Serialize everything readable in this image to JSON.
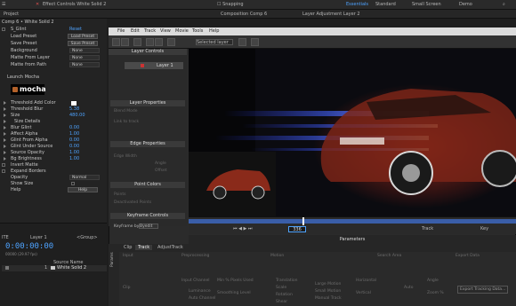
{
  "topbar": {
    "effect_controls_tab": "Effect Controls White Solid 2",
    "snapping": "Snapping",
    "workspaces": [
      "Essentials",
      "Standard",
      "Small Screen",
      "Demo"
    ],
    "search_placeholder": "Search Help"
  },
  "tabbar": {
    "project": "Project",
    "comp_tab": "Composition Comp 6",
    "layer_tab": "Layer Adjustment Layer 2"
  },
  "effect_controls": {
    "comp_layer": "Comp 6 • White Solid 2",
    "effect_name": "S_Glint",
    "reset": "Reset",
    "rows": [
      {
        "label": "Load Preset",
        "button": "Load Preset"
      },
      {
        "label": "Save Preset",
        "button": "Save Preset"
      },
      {
        "label": "Background",
        "dropdown": "None"
      },
      {
        "label": "Matte From Layer",
        "dropdown": "None"
      },
      {
        "label": "Matte from Path",
        "dropdown": "None"
      }
    ],
    "launch_mocha": "Launch Mocha",
    "mocha_logo": "mocha",
    "params": [
      {
        "label": "Threshold Add Color",
        "value": ""
      },
      {
        "label": "Threshold Blur",
        "value": "5.38"
      },
      {
        "label": "Size",
        "value": "480.00"
      },
      {
        "label": "Size Details",
        "value": ""
      },
      {
        "label": "Blur Glint",
        "value": "0.00"
      },
      {
        "label": "Affect Alpha",
        "value": "1.00"
      },
      {
        "label": "Glint From Alpha",
        "value": "0.00"
      },
      {
        "label": "Glint Under Source",
        "value": "0.00"
      },
      {
        "label": "Source Opacity",
        "value": "1.00"
      },
      {
        "label": "Bg Brightness",
        "value": "1.00"
      },
      {
        "label": "Invert Matte",
        "value": ""
      },
      {
        "label": "Expand Borders",
        "value": ""
      },
      {
        "label": "Opacity",
        "value": "Normal"
      },
      {
        "label": "Show Size",
        "value": ""
      },
      {
        "label": "Help",
        "value": "Help"
      }
    ]
  },
  "timeline_left": {
    "layer_label": "Layer 1",
    "group": "<Group>",
    "timecode": "0:00:00:00",
    "fps": "00000 (29.97 fps)",
    "source_name_header": "Source Name",
    "layer_name": "White Solid 2",
    "layer_number": "1"
  },
  "mocha_window": {
    "menu": [
      "File",
      "Edit",
      "Track",
      "View",
      "Movie",
      "Tools",
      "Help"
    ],
    "selected_layer": "Selected layer",
    "layer_controls": "Layer Controls",
    "layer_item": "Layer 1",
    "layer_properties": "Layer Properties",
    "blend_mode": "Blend Mode",
    "link_to_track": "Link to track",
    "adjusted": "Adjusted",
    "edge_properties": "Edge Properties",
    "edge_width": "Edge Width",
    "angle": "Angle",
    "offset": "Offset",
    "point_colors": "Point Colors",
    "points": "Points",
    "deactivated_points": "Deactivated Points",
    "keyframe_controls": "Keyframe Controls",
    "keyframe_by": "Keyframe by",
    "byedit": "Byedit",
    "parameters": "Parameters",
    "frame_value": "336",
    "track": "Track",
    "key": "Key",
    "tabs": [
      "Clip",
      "Track",
      "AdjustTrack"
    ],
    "side_tab": "Params",
    "param_sections": [
      "Input",
      "Preprocessing",
      "Motion",
      "Search Area",
      "Export Data"
    ],
    "param_labels": [
      "Clip",
      "Input Channel",
      "Luminance",
      "Auto Channel",
      "Min % Pixels Used",
      "Smoothing Level",
      "Translation",
      "Scale",
      "Rotation",
      "Shear",
      "Perspective",
      "Large Motion",
      "Small Motion",
      "Manual Track",
      "Horizontal",
      "Vertical",
      "Angle",
      "Zoom %",
      "Auto",
      "Export Tracking Data..."
    ]
  }
}
